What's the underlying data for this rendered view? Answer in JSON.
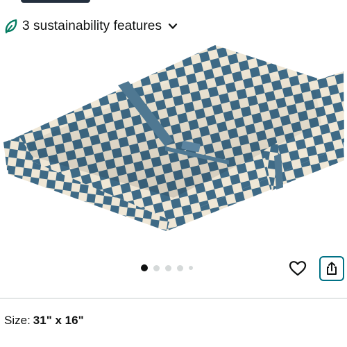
{
  "sustainability": {
    "label": "3 sustainability features",
    "icon": "leaf-icon",
    "accent": "#067d62"
  },
  "product_image": {
    "pattern_color": "#3e6a86",
    "base_color": "#efe7d6"
  },
  "carousel": {
    "total_dots": 5,
    "active_index": 0
  },
  "actions": {
    "favorite_icon": "heart-icon",
    "share_icon": "share-icon",
    "share_border": "#007185"
  },
  "size": {
    "label": "Size:",
    "value": "31\" x 16\""
  }
}
